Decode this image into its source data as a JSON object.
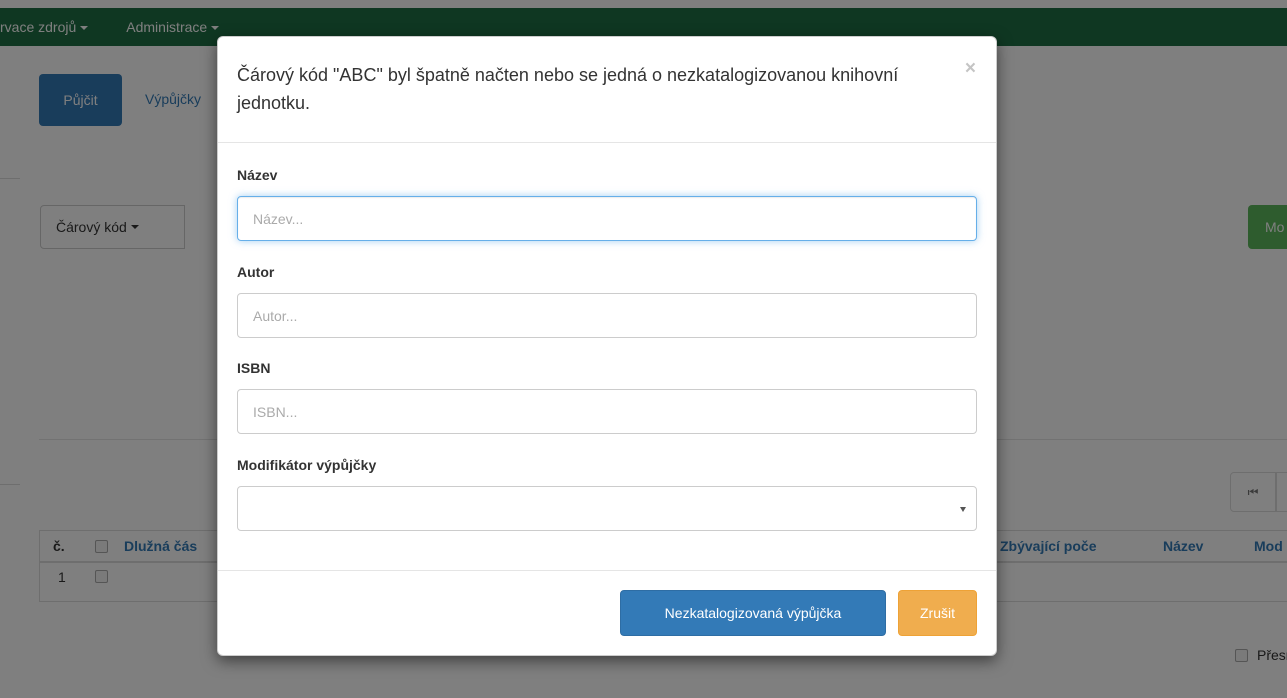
{
  "navbar": {
    "items": [
      {
        "label": "rvace zdrojů"
      },
      {
        "label": "Administrace"
      }
    ]
  },
  "tabs": {
    "active_label": "Půjčit",
    "second_label": "Výpůjčky"
  },
  "barcode_dropdown": {
    "label": "Čárový kód"
  },
  "right_button": {
    "label": "Mo"
  },
  "pager": {
    "first_icon": "first-page-icon",
    "first_glyph": "⏮"
  },
  "table": {
    "headers": {
      "num": "č.",
      "debt": "Dlužná čás",
      "remaining": "Zbývající poče",
      "name": "Název",
      "modifier": "Mod"
    },
    "rows": [
      {
        "num": "1"
      }
    ]
  },
  "exact_option": {
    "label": "Přesný"
  },
  "modal": {
    "title": "Čárový kód \"ABC\" byl špatně načten nebo se jedná o nezkatalogizovanou knihovní jednotku.",
    "close_glyph": "×",
    "fields": {
      "name": {
        "label": "Název",
        "placeholder": "Název..."
      },
      "author": {
        "label": "Autor",
        "placeholder": "Autor..."
      },
      "isbn": {
        "label": "ISBN",
        "placeholder": "ISBN..."
      },
      "modifier": {
        "label": "Modifikátor výpůjčky",
        "value": ""
      }
    },
    "primary_button": "Nezkatalogizovaná výpůjčka",
    "cancel_button": "Zrušit"
  },
  "colors": {
    "navbar": "#1e6e45",
    "primary": "#337ab7",
    "success": "#5cb85c",
    "warning": "#f0ad4e"
  }
}
